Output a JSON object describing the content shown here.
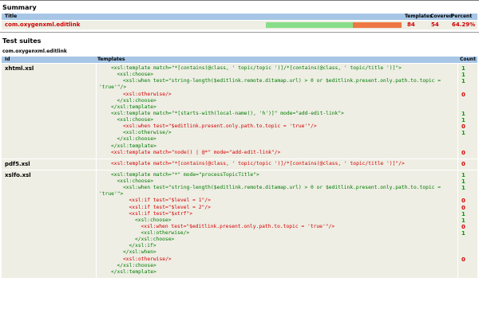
{
  "summary": {
    "title": "Summary",
    "headers": {
      "title": "Title",
      "templates": "Templates",
      "covered": "Covered",
      "percent": "Percent"
    },
    "row": {
      "name": "com.oxygenxml.editlink",
      "templates": "84",
      "covered": "54",
      "percent": "64.29%",
      "covered_fraction": 0.6429
    },
    "colors": {
      "covered": "#88dd88",
      "uncovered": "#ee7744",
      "header": "#a7c6e6",
      "row": "#eeeee4",
      "ok": "#00a000",
      "bad": "#d40000"
    }
  },
  "test_suites": {
    "title": "Test suites",
    "package": "com.oxygenxml.editlink",
    "headers": {
      "id": "Id",
      "templates": "Templates",
      "count": "Count"
    },
    "suites": [
      {
        "id": "xhtml.xsl",
        "lines": [
          {
            "text": "<xsl:template match=\"*[contains(@class, ' topic/topic ')]/*[contains(@class, ' topic/title ')]\">",
            "indent": 0,
            "color": "g",
            "count": "1"
          },
          {
            "text": "<xsl:choose>",
            "indent": 1,
            "color": "g",
            "count": "1"
          },
          {
            "text": "<xsl:when test=\"string-length($editlink.remote.ditamap.url) > 0 or $editlink.present.only.path.to.topic =",
            "indent": 2,
            "color": "g",
            "count": "1"
          },
          {
            "text": "'true'\"/>",
            "indent": -1,
            "color": "g",
            "count": ""
          },
          {
            "text": "<xsl:otherwise/>",
            "indent": 2,
            "color": "r",
            "count": "0"
          },
          {
            "text": "</xsl:choose>",
            "indent": 1,
            "color": "g",
            "count": ""
          },
          {
            "text": "</xsl:template>",
            "indent": 0,
            "color": "g",
            "count": ""
          },
          {
            "text": "<xsl:template match=\"*[starts-with(local-name(), 'h')]\" mode=\"add-edit-link\">",
            "indent": 0,
            "color": "g",
            "count": "1"
          },
          {
            "text": "<xsl:choose>",
            "indent": 1,
            "color": "g",
            "count": "1"
          },
          {
            "text": "<xsl:when test=\"$editlink.present.only.path.to.topic = 'true'\"/>",
            "indent": 2,
            "color": "r",
            "count": "0"
          },
          {
            "text": "<xsl:otherwise/>",
            "indent": 2,
            "color": "g",
            "count": "1"
          },
          {
            "text": "</xsl:choose>",
            "indent": 1,
            "color": "g",
            "count": ""
          },
          {
            "text": "</xsl:template>",
            "indent": 0,
            "color": "g",
            "count": ""
          },
          {
            "text": "<xsl:template match=\"node() | @*\" mode=\"add-edit-link\"/>",
            "indent": 0,
            "color": "r",
            "count": "0"
          }
        ]
      },
      {
        "id": "pdf5.xsl",
        "lines": [
          {
            "text": "<xsl:template match=\"*[contains(@class, ' topic/topic ')]/*[contains(@class, ' topic/title ')]\"/>",
            "indent": 0,
            "color": "r",
            "count": "0"
          }
        ]
      },
      {
        "id": "xslfo.xsl",
        "lines": [
          {
            "text": "<xsl:template match=\"*\" mode=\"processTopicTitle\">",
            "indent": 0,
            "color": "g",
            "count": "1"
          },
          {
            "text": "<xsl:choose>",
            "indent": 1,
            "color": "g",
            "count": "1"
          },
          {
            "text": "<xsl:when test=\"string-length($editlink.remote.ditamap.url) > 0 or $editlink.present.only.path.to.topic =",
            "indent": 2,
            "color": "g",
            "count": "1"
          },
          {
            "text": "'true'\">",
            "indent": -1,
            "color": "g",
            "count": ""
          },
          {
            "text": "<xsl:if test=\"$level = 1\"/>",
            "indent": 3,
            "color": "r",
            "count": "0"
          },
          {
            "text": "<xsl:if test=\"$level = 2\"/>",
            "indent": 3,
            "color": "r",
            "count": "0"
          },
          {
            "text": "<xsl:if test=\"$xtrf\">",
            "indent": 3,
            "color": "r",
            "count": "1"
          },
          {
            "text": "<xsl:choose>",
            "indent": 4,
            "color": "g",
            "count": "1"
          },
          {
            "text": "<xsl:when test=\"$editlink.present.only.path.to.topic = 'true'\"/>",
            "indent": 5,
            "color": "r",
            "count": "0"
          },
          {
            "text": "<xsl:otherwise/>",
            "indent": 5,
            "color": "g",
            "count": "1"
          },
          {
            "text": "</xsl:choose>",
            "indent": 4,
            "color": "g",
            "count": ""
          },
          {
            "text": "</xsl:if>",
            "indent": 3,
            "color": "g",
            "count": ""
          },
          {
            "text": "</xsl:when>",
            "indent": 2,
            "color": "g",
            "count": ""
          },
          {
            "text": "<xsl:otherwise/>",
            "indent": 2,
            "color": "r",
            "count": "0"
          },
          {
            "text": "</xsl:choose>",
            "indent": 1,
            "color": "g",
            "count": ""
          },
          {
            "text": "</xsl:template>",
            "indent": 0,
            "color": "g",
            "count": ""
          }
        ]
      }
    ]
  }
}
